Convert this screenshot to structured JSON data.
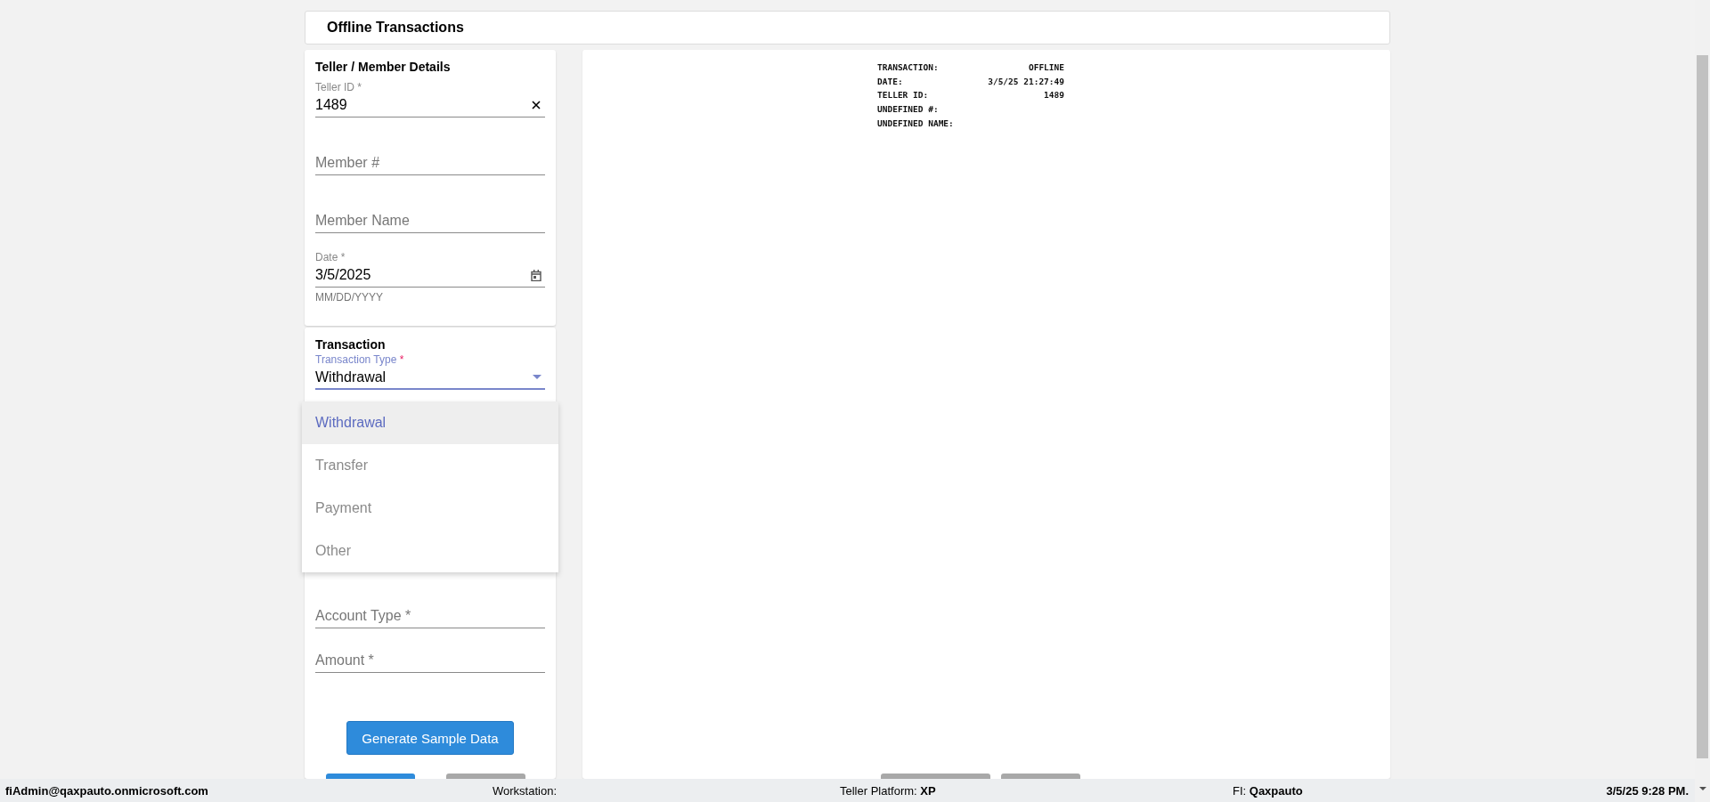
{
  "header": {
    "title": "Offline Transactions"
  },
  "details": {
    "title": "Teller / Member Details",
    "fields": [
      {
        "kind": "text",
        "label": "Teller ID *",
        "value": "1489",
        "clearable": true
      },
      {
        "kind": "text",
        "placeholder": "Member #"
      },
      {
        "kind": "text",
        "placeholder": "Member Name"
      },
      {
        "kind": "date",
        "label": "Date *",
        "value": "3/5/2025",
        "hint": "MM/DD/YYYY"
      }
    ]
  },
  "transaction": {
    "title": "Transaction",
    "type_field": {
      "label": "Transaction Type",
      "required_mark": "*",
      "value": "Withdrawal",
      "focused": true
    },
    "menu": [
      {
        "label": "Withdrawal",
        "selected": true
      },
      {
        "label": "Transfer",
        "selected": false
      },
      {
        "label": "Payment",
        "selected": false
      },
      {
        "label": "Other",
        "selected": false
      }
    ],
    "fields": [
      {
        "placeholder": "Account Type *"
      },
      {
        "placeholder": "Amount *"
      }
    ],
    "sample_button": "Generate Sample Data"
  },
  "receipt": [
    {
      "label": "TRANSACTION:",
      "value": "OFFLINE"
    },
    {
      "label": "DATE:",
      "value": "3/5/25 21:27:49"
    },
    {
      "label": "TELLER ID:",
      "value": "1489"
    },
    {
      "label": "UNDEFINED #:"
    },
    {
      "label": "UNDEFINED NAME:"
    }
  ],
  "status_bar": {
    "user": "fiAdmin@qaxpauto.onmicrosoft.com",
    "workstation_label": "Workstation:",
    "platform_label": "Teller Platform:",
    "platform": "XP",
    "fi_label": "FI:",
    "fi": "Qaxpauto",
    "time": "3/5/25 9:28 PM."
  }
}
